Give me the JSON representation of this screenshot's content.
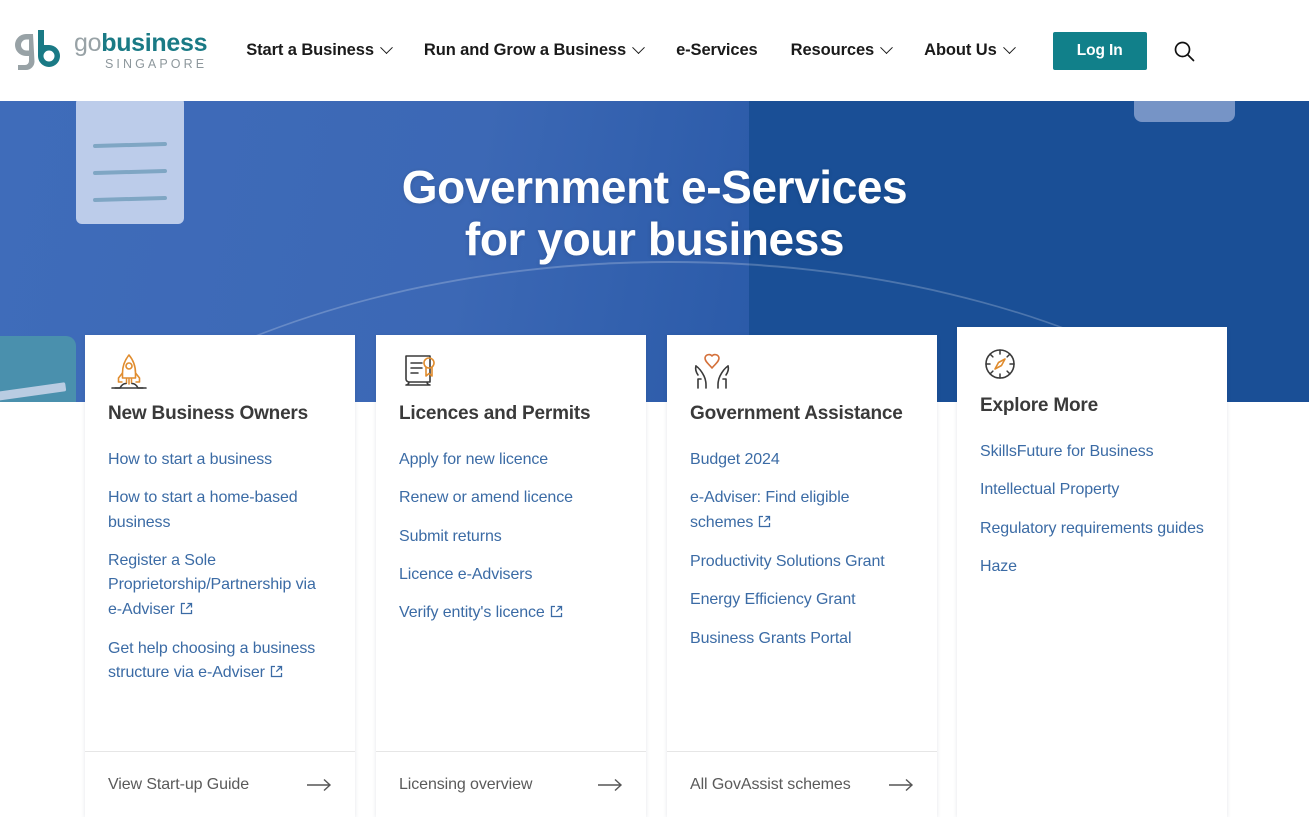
{
  "header": {
    "logo": {
      "mark_icon": "gb-logo-icon",
      "word_go": "go",
      "word_business": "business",
      "word_country": "SINGAPORE",
      "color_teal": "#1a7a85",
      "color_grey": "#98a2a6"
    },
    "nav_items": [
      {
        "label": "Start a Business",
        "has_caret": true
      },
      {
        "label": "Run and Grow a Business",
        "has_caret": true
      },
      {
        "label": "e-Services",
        "has_caret": false
      },
      {
        "label": "Resources",
        "has_caret": true
      },
      {
        "label": "About Us",
        "has_caret": true
      }
    ],
    "login_label": "Log In",
    "login_color": "#11808a",
    "search_icon": "search-icon"
  },
  "hero": {
    "title_line1": "Government e-Services",
    "title_line2": "for your business",
    "background_color": "#3c68b5",
    "background_color_right": "#1a4f96"
  },
  "cards": [
    {
      "icon": "rocket-icon",
      "title": "New Business Owners",
      "links": [
        {
          "label": "How to start a business",
          "external": false
        },
        {
          "label": "How to start a home-based business",
          "external": false
        },
        {
          "label": "Register a Sole Proprietorship/Partnership via e-Adviser",
          "external": true
        },
        {
          "label": "Get help choosing a business structure via e-Adviser",
          "external": true
        }
      ],
      "footer_label": "View Start-up Guide",
      "footer_icon": "arrow-right-icon"
    },
    {
      "icon": "certificate-icon",
      "title": "Licences and Permits",
      "links": [
        {
          "label": "Apply for new licence",
          "external": false
        },
        {
          "label": "Renew or amend licence",
          "external": false
        },
        {
          "label": "Submit returns",
          "external": false
        },
        {
          "label": "Licence e-Advisers",
          "external": false
        },
        {
          "label": "Verify entity's licence",
          "external": true
        }
      ],
      "footer_label": "Licensing overview",
      "footer_icon": "arrow-right-icon"
    },
    {
      "icon": "heart-hands-icon",
      "title": "Government Assistance",
      "links": [
        {
          "label": "Budget 2024",
          "external": false
        },
        {
          "label": "e-Adviser: Find eligible schemes",
          "external": true
        },
        {
          "label": "Productivity Solutions Grant",
          "external": false
        },
        {
          "label": "Energy Efficiency Grant",
          "external": false
        },
        {
          "label": "Business Grants Portal",
          "external": false
        }
      ],
      "footer_label": "All GovAssist schemes",
      "footer_icon": "arrow-right-icon"
    },
    {
      "icon": "compass-icon",
      "title": "Explore More",
      "links": [
        {
          "label": "SkillsFuture for Business",
          "external": false
        },
        {
          "label": "Intellectual Property",
          "external": false
        },
        {
          "label": "Regulatory requirements guides",
          "external": false
        },
        {
          "label": "Haze",
          "external": false
        }
      ],
      "footer_label": "",
      "footer_icon": ""
    }
  ]
}
